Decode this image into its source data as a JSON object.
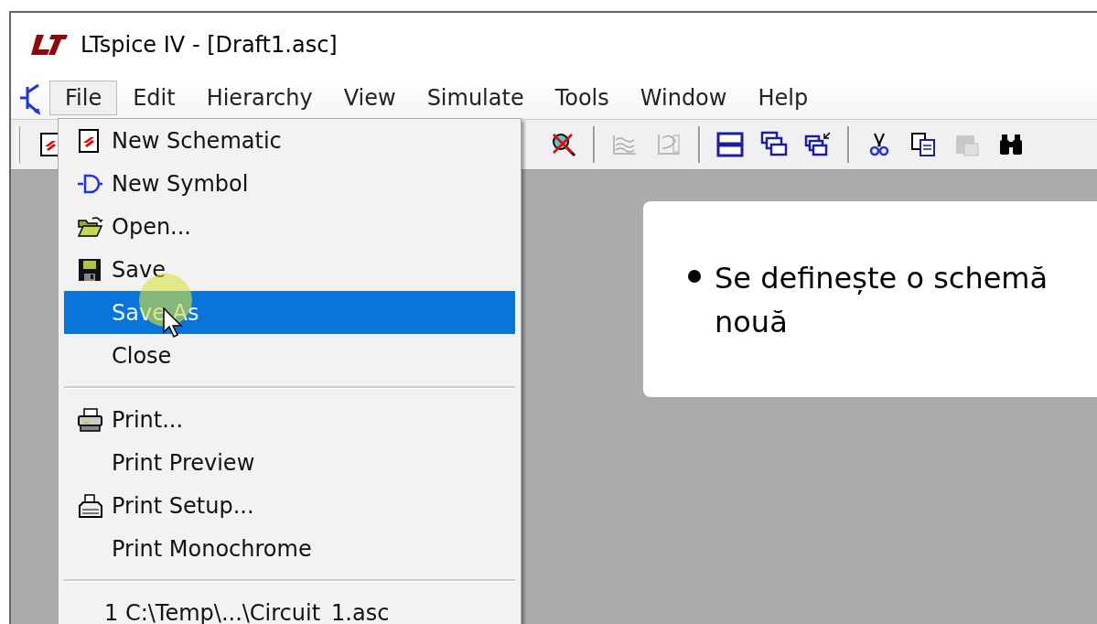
{
  "window": {
    "title": "LTspice IV - [Draft1.asc]"
  },
  "menu_bar": [
    {
      "label": "File",
      "selected": true
    },
    {
      "label": "Edit",
      "selected": false
    },
    {
      "label": "Hierarchy",
      "selected": false
    },
    {
      "label": "View",
      "selected": false
    },
    {
      "label": "Simulate",
      "selected": false
    },
    {
      "label": "Tools",
      "selected": false
    },
    {
      "label": "Window",
      "selected": false
    },
    {
      "label": "Help",
      "selected": false
    }
  ],
  "toolbar": [
    {
      "kind": "new-schematic",
      "disabled": false
    },
    {
      "kind": "zoom-cancel",
      "disabled": false
    },
    {
      "kind": "separator"
    },
    {
      "kind": "waveform",
      "disabled": true
    },
    {
      "kind": "plot",
      "disabled": true
    },
    {
      "kind": "separator"
    },
    {
      "kind": "tile",
      "disabled": false
    },
    {
      "kind": "cascade",
      "disabled": false
    },
    {
      "kind": "cascade-arrow",
      "disabled": false
    },
    {
      "kind": "separator"
    },
    {
      "kind": "cut",
      "disabled": false
    },
    {
      "kind": "copy",
      "disabled": false
    },
    {
      "kind": "paste",
      "disabled": true
    },
    {
      "kind": "find",
      "disabled": false
    }
  ],
  "file_menu": [
    {
      "kind": "new-schematic",
      "label": "New Schematic",
      "selected": false
    },
    {
      "kind": "new-symbol",
      "label": "New Symbol",
      "selected": false
    },
    {
      "kind": "open",
      "label": "Open...",
      "selected": false
    },
    {
      "kind": "save",
      "label": "Save",
      "selected": false
    },
    {
      "kind": "plain",
      "label": "Save As",
      "selected": true
    },
    {
      "kind": "plain",
      "label": "Close",
      "selected": false
    },
    {
      "kind": "separator"
    },
    {
      "kind": "print",
      "label": "Print...",
      "selected": false
    },
    {
      "kind": "plain",
      "label": "Print Preview",
      "selected": false
    },
    {
      "kind": "print-setup",
      "label": "Print Setup...",
      "selected": false
    },
    {
      "kind": "plain",
      "label": "Print Monochrome",
      "selected": false
    },
    {
      "kind": "separator"
    },
    {
      "kind": "recent",
      "label": "1 C:\\Temp\\...\\Circuit_1.asc",
      "selected": false
    }
  ],
  "callout": {
    "bullets": [
      "Se definește o schemă nouă"
    ]
  }
}
